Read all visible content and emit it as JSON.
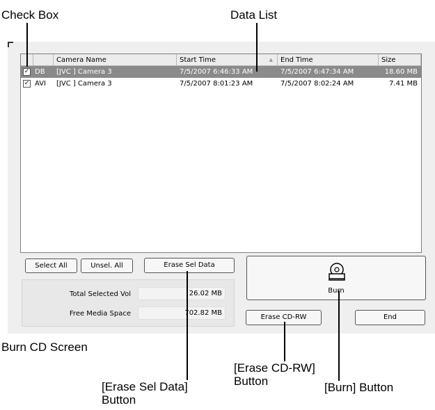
{
  "callouts": {
    "check_box": "Check Box",
    "data_list": "Data List",
    "burn_cd_screen": "Burn CD Screen",
    "erase_cd_rw_line1": "[Erase CD-RW]",
    "erase_cd_rw_line2": "Button",
    "burn_button": "[Burn] Button",
    "erase_sel_data_line1": "[Erase Sel Data]",
    "erase_sel_data_line2": "Button"
  },
  "list": {
    "columns": [
      "",
      "",
      "Camera Name",
      "Start Time",
      "End Time",
      "Size"
    ],
    "sort_indicator": "▲",
    "rows": [
      {
        "checked": true,
        "checkmark": "✓",
        "type": "DB",
        "camera": "[JVC ] Camera 3",
        "start": "7/5/2007 6:46:33 AM",
        "end": "7/5/2007 6:47:34 AM",
        "size": "18.60 MB",
        "selected": true
      },
      {
        "checked": true,
        "checkmark": "✓",
        "type": "AVI",
        "camera": "[JVC ] Camera 3",
        "start": "7/5/2007 8:01:23 AM",
        "end": "7/5/2007 8:02:24 AM",
        "size": "7.41 MB",
        "selected": false
      }
    ]
  },
  "buttons": {
    "select_all": "Select All",
    "unsel_all": "Unsel. All",
    "erase_sel_data": "Erase Sel Data",
    "burn": "Burn",
    "erase_cd_rw": "Erase CD-RW",
    "end": "End"
  },
  "stats": {
    "total_selected_label": "Total Selected Vol",
    "total_selected_value": "26.02 MB",
    "free_space_label": "Free Media Space",
    "free_space_value": "702.82 MB"
  },
  "icons": {
    "burn": "cd-disc-icon"
  }
}
